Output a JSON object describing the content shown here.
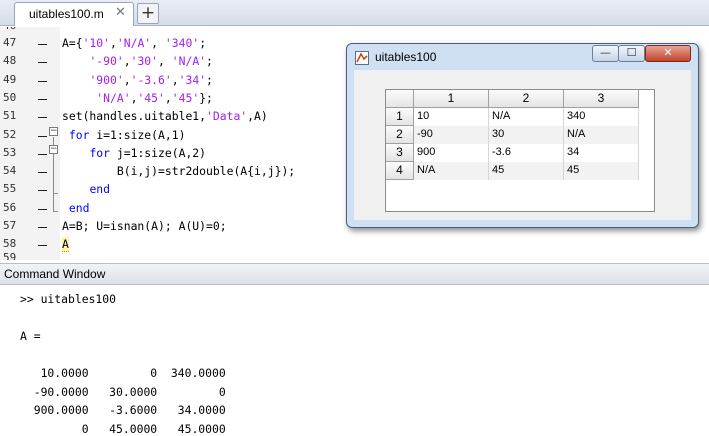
{
  "editor": {
    "tab": {
      "label": "uitables100.m",
      "close_glyph": "✕"
    },
    "new_tab_glyph": "+",
    "partial_line_top": "46",
    "partial_line_bottom": "59",
    "lines": [
      {
        "num": "47",
        "parts": [
          [
            "",
            "A={"
          ],
          [
            "str",
            "'10'"
          ],
          [
            "",
            ","
          ],
          [
            "str",
            "'N/A'"
          ],
          [
            "",
            ", "
          ],
          [
            "str",
            "'340'"
          ],
          [
            "",
            ";"
          ]
        ]
      },
      {
        "num": "48",
        "parts": [
          [
            "",
            "    "
          ],
          [
            "str",
            "'-90'"
          ],
          [
            "",
            ","
          ],
          [
            "str",
            "'30'"
          ],
          [
            "",
            ", "
          ],
          [
            "str",
            "'N/A'"
          ],
          [
            "",
            ";"
          ]
        ]
      },
      {
        "num": "49",
        "parts": [
          [
            "",
            "    "
          ],
          [
            "str",
            "'900'"
          ],
          [
            "",
            ","
          ],
          [
            "str",
            "'-3.6'"
          ],
          [
            "",
            ","
          ],
          [
            "str",
            "'34'"
          ],
          [
            "",
            ";"
          ]
        ]
      },
      {
        "num": "50",
        "parts": [
          [
            "",
            "     "
          ],
          [
            "str",
            "'N/A'"
          ],
          [
            "",
            ","
          ],
          [
            "str",
            "'45'"
          ],
          [
            "",
            ","
          ],
          [
            "str",
            "'45'"
          ],
          [
            "",
            "};"
          ]
        ]
      },
      {
        "num": "51",
        "parts": [
          [
            "",
            "set(handles.uitable1,"
          ],
          [
            "str",
            "'Data'"
          ],
          [
            "",
            ",A)"
          ]
        ]
      },
      {
        "num": "52",
        "parts": [
          [
            "",
            " "
          ],
          [
            "kw",
            "for"
          ],
          [
            "",
            " i=1:size(A,1)"
          ]
        ]
      },
      {
        "num": "53",
        "parts": [
          [
            "",
            "    "
          ],
          [
            "kw",
            "for"
          ],
          [
            "",
            " j=1:size(A,2)"
          ]
        ]
      },
      {
        "num": "54",
        "parts": [
          [
            "",
            "        B(i,j)=str2double(A{i,j});"
          ]
        ]
      },
      {
        "num": "55",
        "parts": [
          [
            "",
            "    "
          ],
          [
            "kw",
            "end"
          ]
        ]
      },
      {
        "num": "56",
        "parts": [
          [
            "",
            " "
          ],
          [
            "kw",
            "end"
          ]
        ]
      },
      {
        "num": "57",
        "parts": [
          [
            "",
            "A=B; U=isnan(A); A(U)=0;"
          ]
        ]
      },
      {
        "num": "58",
        "parts": [
          [
            "warn",
            "A"
          ]
        ]
      }
    ]
  },
  "figure": {
    "title": "uitables100",
    "min_glyph": "—",
    "max_glyph": "☐",
    "close_glyph": "✕",
    "table": {
      "col_headers": [
        "1",
        "2",
        "3"
      ],
      "row_headers": [
        "1",
        "2",
        "3",
        "4"
      ],
      "rows": [
        [
          "10",
          "N/A",
          "340"
        ],
        [
          "-90",
          "30",
          "N/A"
        ],
        [
          "900",
          "-3.6",
          "34"
        ],
        [
          "N/A",
          "45",
          "45"
        ]
      ]
    }
  },
  "command_window": {
    "title": "Command Window",
    "lines": [
      ">> uitables100",
      "",
      "A =",
      "",
      "   10.0000         0  340.0000",
      "  -90.0000   30.0000         0",
      "  900.0000   -3.6000   34.0000",
      "         0   45.0000   45.0000"
    ]
  },
  "colors": {
    "keyword": "#0000ff",
    "string": "#a020f0",
    "figure_frame": "#cfe0f3",
    "close_button": "#c4432b"
  }
}
